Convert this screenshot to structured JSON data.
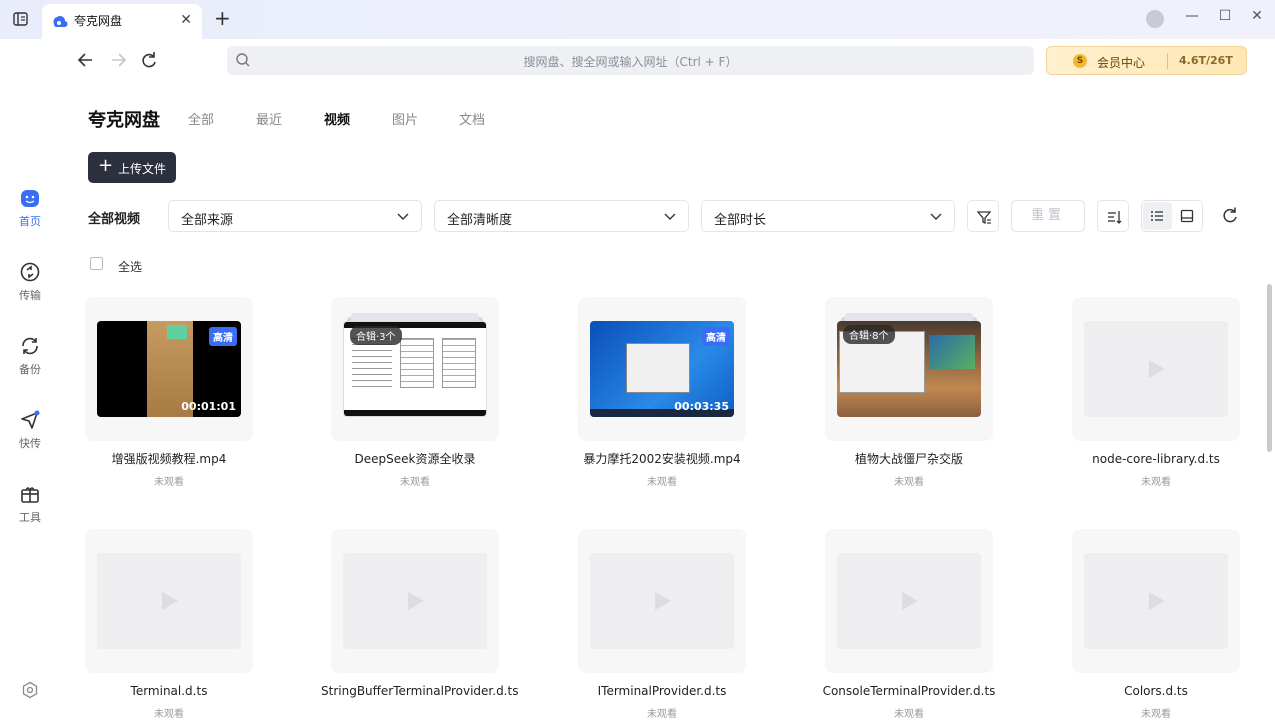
{
  "titlebar": {
    "tab_title": "夸克网盘",
    "tab_close": "✕",
    "tab_add": "+",
    "minimize": "—",
    "maximize": "☐",
    "close": "✕"
  },
  "toolbar": {
    "search_placeholder": "搜网盘、搜全网或输入网址（Ctrl + F）",
    "vip_label": "会员中心",
    "vip_coin": "S",
    "storage": "4.6T/26T"
  },
  "leftnav": {
    "items": [
      {
        "label": "首页",
        "icon": "home-icon"
      },
      {
        "label": "传输",
        "icon": "transfer-icon"
      },
      {
        "label": "备份",
        "icon": "backup-icon"
      },
      {
        "label": "快传",
        "icon": "quick-send-icon"
      },
      {
        "label": "工具",
        "icon": "toolbox-icon"
      }
    ]
  },
  "main": {
    "brand": "夸克网盘",
    "tabs": [
      {
        "label": "全部",
        "active": false
      },
      {
        "label": "最近",
        "active": false
      },
      {
        "label": "视频",
        "active": true
      },
      {
        "label": "图片",
        "active": false
      },
      {
        "label": "文档",
        "active": false
      }
    ],
    "upload_label": "上传文件",
    "filter_label": "全部视频",
    "filters": [
      "全部来源",
      "全部清晰度",
      "全部时长"
    ],
    "reset_label": "重置",
    "select_all": "全选"
  },
  "cards": [
    {
      "name": "增强版视频教程.mp4",
      "status": "未观看",
      "type": "video",
      "hd": "高清",
      "duration": "00:01:01"
    },
    {
      "name": "DeepSeek资源全收录",
      "status": "未观看",
      "type": "collection",
      "collection": "合辑·3个"
    },
    {
      "name": "暴力摩托2002安装视频.mp4",
      "status": "未观看",
      "type": "video",
      "hd": "高清",
      "duration": "00:03:35"
    },
    {
      "name": "植物大战僵尸杂交版",
      "status": "未观看",
      "type": "collection",
      "collection": "合辑·8个"
    },
    {
      "name": "node-core-library.d.ts",
      "status": "未观看",
      "type": "empty"
    },
    {
      "name": "Terminal.d.ts",
      "status": "未观看",
      "type": "empty"
    },
    {
      "name": "StringBufferTerminalProvider.d.ts",
      "status": "未观看",
      "type": "empty"
    },
    {
      "name": "ITerminalProvider.d.ts",
      "status": "未观看",
      "type": "empty"
    },
    {
      "name": "ConsoleTerminalProvider.d.ts",
      "status": "未观看",
      "type": "empty"
    },
    {
      "name": "Colors.d.ts",
      "status": "未观看",
      "type": "empty"
    }
  ],
  "colors": {
    "accent": "#3a6cf6",
    "dark_button": "#2c2f3c"
  }
}
